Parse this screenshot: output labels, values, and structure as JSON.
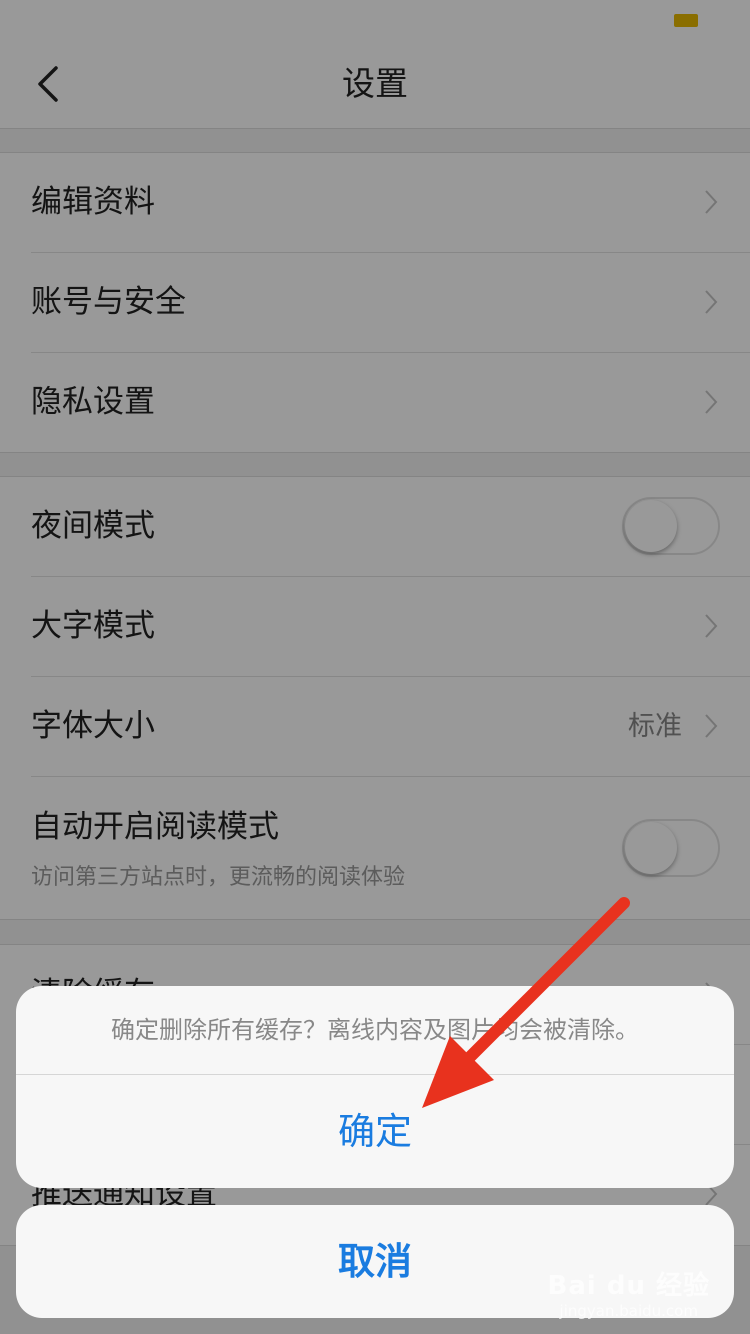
{
  "nav": {
    "title": "设置"
  },
  "group1": [
    {
      "label": "编辑资料"
    },
    {
      "label": "账号与安全"
    },
    {
      "label": "隐私设置"
    }
  ],
  "group2": {
    "night_mode": {
      "label": "夜间模式",
      "on": false
    },
    "large_font": {
      "label": "大字模式"
    },
    "font_size": {
      "label": "字体大小",
      "value": "标准"
    },
    "auto_read": {
      "label": "自动开启阅读模式",
      "sub": "访问第三方站点时，更流畅的阅读体验",
      "on": false
    }
  },
  "group3": {
    "clear_cache": {
      "label": "清除缓存",
      "value": ""
    },
    "push_settings": {
      "label": "推送通知设置"
    }
  },
  "dialog": {
    "message": "确定删除所有缓存？离线内容及图片均会被清除。",
    "confirm": "确定",
    "cancel": "取消"
  },
  "watermark": {
    "brand": "Bai du 经验",
    "sub": "jingyan.baidu.com"
  },
  "colors": {
    "accent": "#1a7ce0",
    "annotation_arrow": "#e8321e",
    "battery": "#e6b800"
  }
}
